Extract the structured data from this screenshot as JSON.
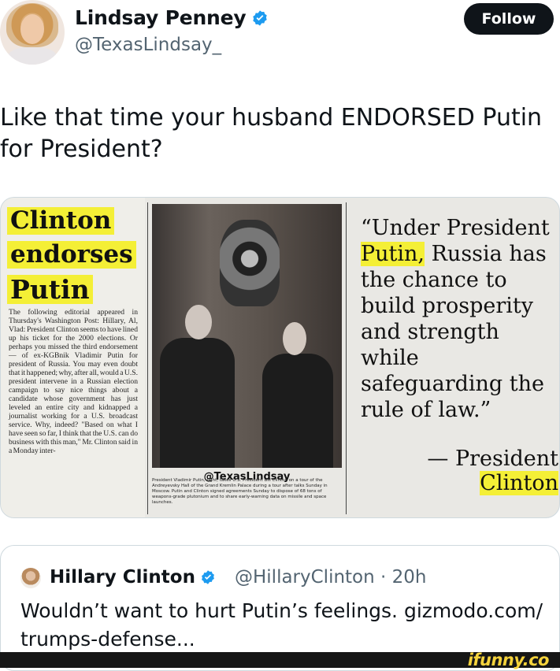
{
  "author": {
    "name": "Lindsay Penney",
    "handle": "@TexasLindsay_"
  },
  "follow_label": "Follow",
  "tweet_text": "Like that time your husband ENDORSED Putin for President?",
  "clipping": {
    "headline": [
      "Clinton",
      "endorses",
      "Putin"
    ],
    "article": "The following editorial appeared in Thursday's Washington Post: Hillary, Al, Vlad: President Clinton seems to have lined up his ticket for the 2000 elections. Or perhaps you missed the third endorsement — of ex-KGBnik Vladimir Putin for president of Russia. You may even doubt that it happened; why, after all, would a U.S. president intervene in a Russian election campaign to say nice things about a candidate whose government has just leveled an entire city and kidnapped a journalist working for a U.S. broadcast service. Why, indeed? \"Based on what I have seen so far, I think that the U.S. can do business with this man,\" Mr. Clinton said in a Monday inter-",
    "photo_watermark": "@TexasLindsay",
    "caption": "President Vladimir Putin, right, takes U.S. President Bill Clinton on a tour of the Andreyevsky Hall of the Grand Kremlin Palace during a tour after talks Sunday in Moscow. Putin and Clinton signed agreements Sunday to dispose of 68 tons of weapons-grade plutonium and to share early-warning data on missile and space launches.",
    "quote_before": "“Under President ",
    "quote_highlight": "Putin,",
    "quote_after": " Russia has the chance to build prosperity and strength while safeguarding the rule of law.”",
    "attribution_line1": "— President",
    "attribution_line2": "Clinton"
  },
  "quoted_tweet": {
    "name": "Hillary Clinton",
    "handle": "@HillaryClinton · 20h",
    "text": "Wouldn’t want to hurt Putin’s feelings. gizmodo.com/ trumps-defense..."
  },
  "watermark": "ifunny.co",
  "colors": {
    "verified": "#1d9bf0",
    "highlight": "#f4ef36",
    "follow_bg": "#0f1419"
  }
}
